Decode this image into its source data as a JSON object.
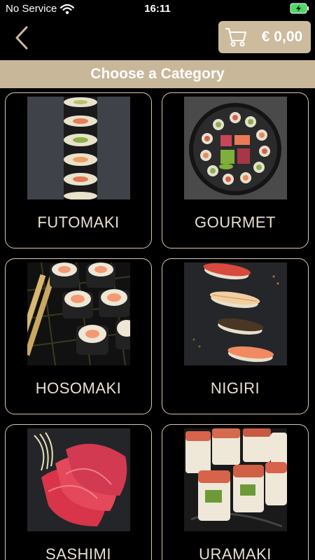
{
  "status_bar": {
    "carrier": "No Service",
    "time": "16:11"
  },
  "nav": {
    "cart_total": "€ 0,00"
  },
  "header": {
    "title": "Choose a Category"
  },
  "categories": [
    {
      "label": "FUTOMAKI"
    },
    {
      "label": "GOURMET"
    },
    {
      "label": "HOSOMAKI"
    },
    {
      "label": "NIGIRI"
    },
    {
      "label": "SASHIMI"
    },
    {
      "label": "URAMAKI"
    }
  ],
  "colors": {
    "accent": "#c9b79a",
    "card_border": "#d8c8aa",
    "background": "#000000"
  }
}
